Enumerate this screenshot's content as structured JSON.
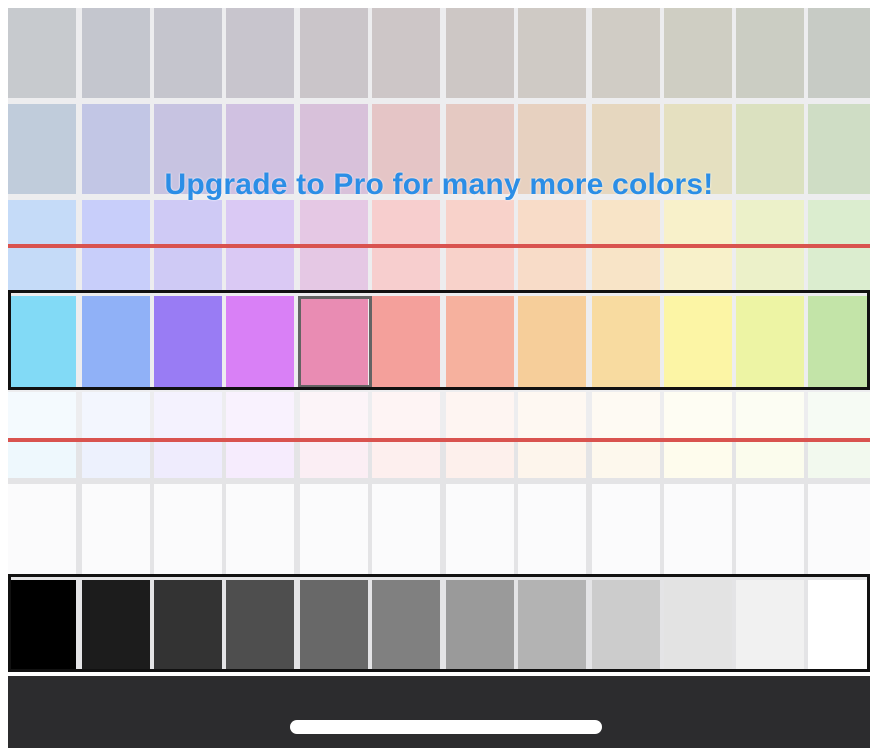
{
  "banner": {
    "text": "Upgrade to Pro for many more colors!",
    "color": "#2b8ee6"
  },
  "accent_line_color": "#d9534f",
  "rows": [
    {
      "locked": true,
      "colors": [
        "#a9aeb4",
        "#a5a8b4",
        "#a6a7b2",
        "#aba6b2",
        "#aea6ad",
        "#b3a8aa",
        "#b2aaa6",
        "#b5aea6",
        "#b7b1a6",
        "#b6b4a4",
        "#b0b3a4",
        "#a9afa6"
      ]
    },
    {
      "locked": true,
      "colors": [
        "#9fb1c8",
        "#a2a8d8",
        "#a9a3d2",
        "#b7a0d2",
        "#c4a0c6",
        "#d8a7a8",
        "#d8ada2",
        "#dbb99f",
        "#d9c29d",
        "#d7d09f",
        "#c8d29f",
        "#b6cba7"
      ]
    },
    {
      "locked": true,
      "colors": [
        "#a6c8f4",
        "#abb4f7",
        "#b5aef0",
        "#c6acee",
        "#d8abd6",
        "#f3b4b4",
        "#f4bbae",
        "#f5c9ab",
        "#f5d6aa",
        "#f5eaae",
        "#e2eaad",
        "#c8e3b6"
      ]
    },
    {
      "locked": false,
      "selected_index": 4,
      "colors": [
        "#3fc6f2",
        "#5588f3",
        "#6337ee",
        "#c53cf1",
        "#de4f8b",
        "#ef6e66",
        "#f1876a",
        "#f1b465",
        "#f4c86d",
        "#fbf076",
        "#e3ee74",
        "#a4d67a"
      ]
    },
    {
      "locked": true,
      "colors": [
        "#eef8fd",
        "#edf1fd",
        "#efecfd",
        "#f6ecfd",
        "#fbeef4",
        "#fdefee",
        "#fdf0ec",
        "#fdf5ec",
        "#fdf8ed",
        "#fefced",
        "#fbfced",
        "#f2f9ee"
      ]
    },
    {
      "locked": false,
      "colors": [
        "#fbfbfc",
        "#fbfbfc",
        "#fbfbfc",
        "#fbfbfc",
        "#fbfbfc",
        "#fbfbfc",
        "#fbfbfc",
        "#fbfbfc",
        "#fbfbfc",
        "#fbfbfc",
        "#fbfbfc",
        "#fbfbfc"
      ]
    },
    {
      "locked": false,
      "colors": [
        "#000000",
        "#1c1c1c",
        "#333333",
        "#4e4e4e",
        "#686868",
        "#808080",
        "#9a9a9a",
        "#b3b3b3",
        "#cccccc",
        "#e3e3e3",
        "#f1f1f1",
        "#ffffff"
      ]
    }
  ],
  "bottom_bar": {
    "background": "#2c2c2e",
    "home_indicator": "home-indicator"
  }
}
